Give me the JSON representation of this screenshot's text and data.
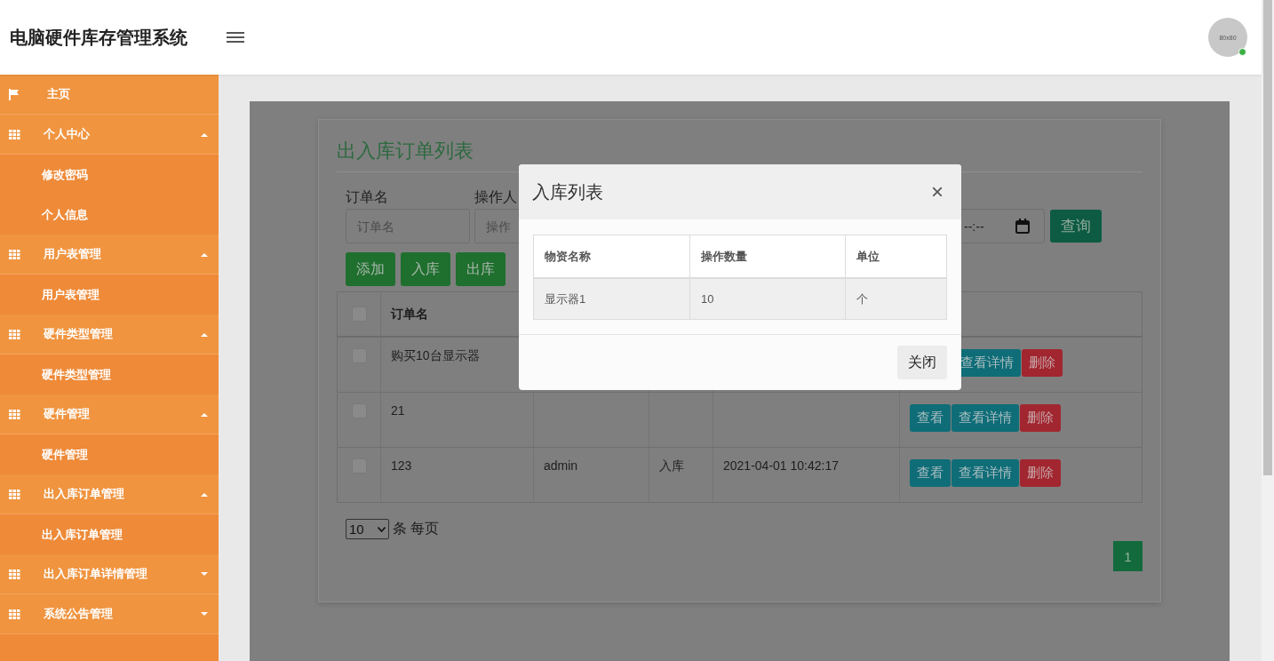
{
  "header": {
    "title": "电脑硬件库存管理系统",
    "avatar_text": "80x80",
    "online": true
  },
  "sidebar": {
    "items": [
      {
        "kind": "link",
        "label": "主页"
      },
      {
        "kind": "group",
        "label": "个人中心",
        "expanded": true,
        "children": [
          {
            "label": "修改密码"
          },
          {
            "label": "个人信息"
          }
        ]
      },
      {
        "kind": "group",
        "label": "用户表管理",
        "expanded": true,
        "children": [
          {
            "label": "用户表管理"
          }
        ]
      },
      {
        "kind": "group",
        "label": "硬件类型管理",
        "expanded": true,
        "children": [
          {
            "label": "硬件类型管理"
          }
        ]
      },
      {
        "kind": "group",
        "label": "硬件管理",
        "expanded": true,
        "children": [
          {
            "label": "硬件管理"
          }
        ]
      },
      {
        "kind": "group",
        "label": "出入库订单管理",
        "expanded": true,
        "children": [
          {
            "label": "出入库订单管理"
          }
        ]
      },
      {
        "kind": "group",
        "label": "出入库订单详情管理",
        "expanded": false
      },
      {
        "kind": "group",
        "label": "系统公告管理",
        "expanded": false
      }
    ]
  },
  "page": {
    "title": "出入库订单列表",
    "filters": [
      {
        "kind": "text",
        "label": "订单名",
        "placeholder": "订单名"
      },
      {
        "kind": "text",
        "label": "操作人",
        "placeholder": "操作"
      },
      {
        "kind": "datetime",
        "value": "--:--"
      }
    ],
    "search_button": "查询",
    "toolbar": [
      {
        "kind": "success",
        "label": "添加"
      },
      {
        "kind": "success",
        "label": "入库"
      },
      {
        "kind": "success",
        "label": "出库"
      }
    ],
    "table": {
      "columns": [
        "订单名"
      ],
      "header_checked": false,
      "rows": [
        {
          "checked": false,
          "cells": [
            "购买10台显示器"
          ],
          "actions": [
            {
              "kind": "detail",
              "label": "查看详情"
            },
            {
              "kind": "delete",
              "label": "删除"
            }
          ]
        },
        {
          "checked": false,
          "cells": [
            "21"
          ],
          "actions": [
            {
              "kind": "view",
              "label": "查看"
            },
            {
              "kind": "detail",
              "label": "查看详情"
            },
            {
              "kind": "delete",
              "label": "删除"
            }
          ]
        },
        {
          "checked": false,
          "cells": [
            "123",
            "admin",
            "入库",
            "2021-04-01 10:42:17"
          ],
          "actions": [
            {
              "kind": "view",
              "label": "查看"
            },
            {
              "kind": "detail",
              "label": "查看详情"
            },
            {
              "kind": "delete",
              "label": "删除"
            }
          ]
        }
      ]
    },
    "pagination": {
      "page_size": "10",
      "page_size_label": "条 每页",
      "pages": [
        {
          "label": "1",
          "selected": true
        }
      ]
    }
  },
  "modal": {
    "title": "入库列表",
    "close_icon": "×",
    "columns": [
      "物资名称",
      "操作数量",
      "单位"
    ],
    "rows": [
      [
        "显示器1",
        "10",
        "个"
      ]
    ],
    "close_button": "关闭"
  }
}
